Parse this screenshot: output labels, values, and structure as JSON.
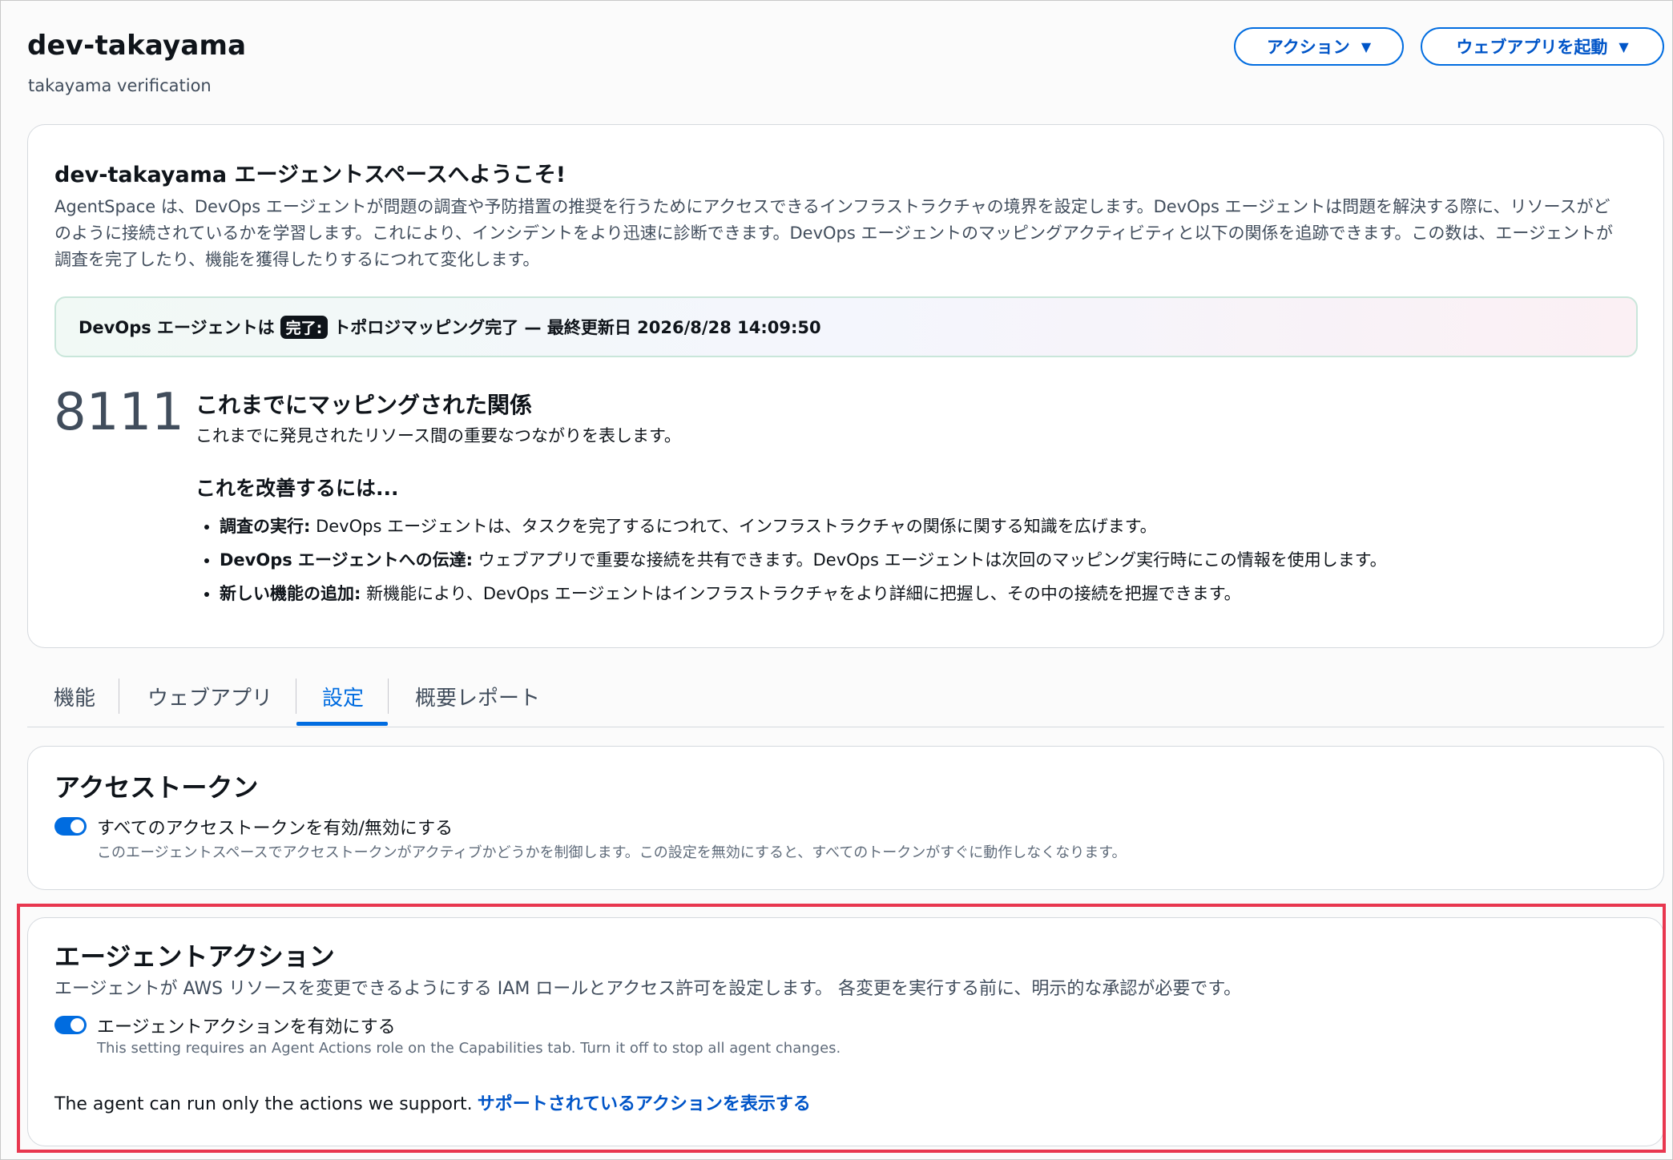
{
  "header": {
    "title": "dev-takayama",
    "subtitle": "takayama verification",
    "actions_button": "アクション",
    "launch_button": "ウェブアプリを起動"
  },
  "welcome": {
    "title": "dev-takayama エージェントスペースへようこそ!",
    "body": "AgentSpace は、DevOps エージェントが問題の調査や予防措置の推奨を行うためにアクセスできるインフラストラクチャの境界を設定します。DevOps エージェントは問題を解決する際に、リソースがどのように接続されているかを学習します。これにより、インシデントをより迅速に診断できます。DevOps エージェントのマッピングアクティビティと以下の関係を追跡できます。この数は、エージェントが調査を完了したり、機能を獲得したりするにつれて変化します。",
    "status_prefix": "DevOps エージェントは",
    "status_badge": "完了:",
    "status_suffix": "トポロジマッピング完了 — 最終更新日 2026/8/28 14:09:50",
    "metric_value": "8111",
    "metric_title": "これまでにマッピングされた関係",
    "metric_desc": "これまでに発見されたリソース間の重要なつながりを表します。",
    "improve_title": "これを改善するには...",
    "improve_items": [
      {
        "label": "調査の実行:",
        "text": "DevOps エージェントは、タスクを完了するにつれて、インフラストラクチャの関係に関する知識を広げます。"
      },
      {
        "label": "DevOps エージェントへの伝達:",
        "text": "ウェブアプリで重要な接続を共有できます。DevOps エージェントは次回のマッピング実行時にこの情報を使用します。"
      },
      {
        "label": "新しい機能の追加:",
        "text": "新機能により、DevOps エージェントはインフラストラクチャをより詳細に把握し、その中の接続を把握できます。"
      }
    ]
  },
  "tabs": [
    "機能",
    "ウェブアプリ",
    "設定",
    "概要レポート"
  ],
  "active_tab": "設定",
  "access_token": {
    "title": "アクセストークン",
    "toggle_label": "すべてのアクセストークンを有効/無効にする",
    "toggle_desc": "このエージェントスペースでアクセストークンがアクティブかどうかを制御します。この設定を無効にすると、すべてのトークンがすぐに動作しなくなります。",
    "enabled": true
  },
  "agent_actions": {
    "title": "エージェントアクション",
    "desc": "エージェントが AWS リソースを変更できるようにする IAM ロールとアクセス許可を設定します。 各変更を実行する前に、明示的な承認が必要です。",
    "toggle_label": "エージェントアクションを有効にする",
    "toggle_desc": "This setting requires an Agent Actions role on the Capabilities tab. Turn it off to stop all agent changes.",
    "enabled": true,
    "footer_text": "The agent can run only the actions we support.",
    "footer_link": "サポートされているアクションを表示する"
  },
  "colors": {
    "accent": "#006ce0",
    "highlight_border": "#e8374f"
  }
}
